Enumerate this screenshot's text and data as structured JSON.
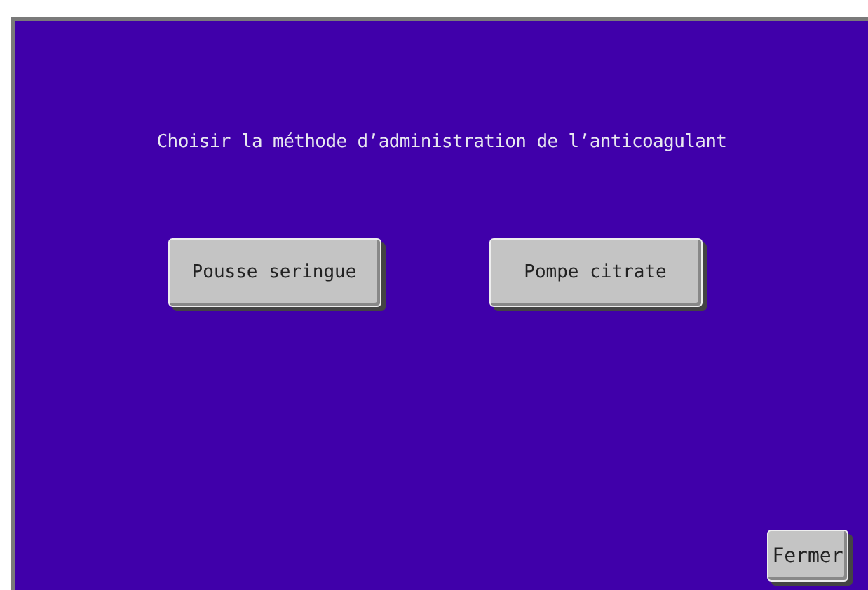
{
  "prompt": "Choisir la méthode d’administration de l’anticoagulant",
  "options": [
    "Pousse seringue",
    "Pompe citrate"
  ],
  "close_button": "Fermer"
}
